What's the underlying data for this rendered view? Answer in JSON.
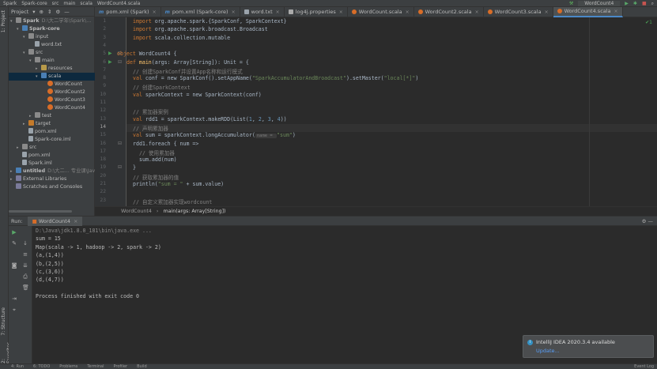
{
  "topbar": {
    "crumbs": [
      "Spark",
      "Spark-core",
      "src",
      "main",
      "scala",
      "WordCount4.scala"
    ],
    "run_config": "WordCount4"
  },
  "left_strip": {
    "project": "1: Project",
    "structure": "7: Structure",
    "favorites": "2: Favorites"
  },
  "project_panel": {
    "title": "Project",
    "tree": [
      {
        "label": "Spark",
        "extra": "D:\\大二学年\\Spark\\...",
        "icon": "folder-icon",
        "arrow": "▾"
      },
      {
        "label": "Spark-core",
        "extra": "",
        "icon": "module-icon",
        "arrow": "▾"
      },
      {
        "label": "input",
        "extra": "",
        "icon": "folder-icon",
        "arrow": "▾"
      },
      {
        "label": "word.txt",
        "extra": "",
        "icon": "text-file-icon",
        "arrow": ""
      },
      {
        "label": "src",
        "extra": "",
        "icon": "folder-icon",
        "arrow": "▾"
      },
      {
        "label": "main",
        "extra": "",
        "icon": "folder-icon",
        "arrow": "▾"
      },
      {
        "label": "resources",
        "extra": "",
        "icon": "resources-folder-icon",
        "arrow": "▸"
      },
      {
        "label": "scala",
        "extra": "",
        "icon": "source-folder-icon",
        "arrow": "▾"
      },
      {
        "label": "WordCount",
        "extra": "",
        "icon": "scala-object-icon",
        "arrow": ""
      },
      {
        "label": "WordCount2",
        "extra": "",
        "icon": "scala-object-icon",
        "arrow": ""
      },
      {
        "label": "WordCount3",
        "extra": "",
        "icon": "scala-object-icon",
        "arrow": ""
      },
      {
        "label": "WordCount4",
        "extra": "",
        "icon": "scala-object-icon",
        "arrow": ""
      },
      {
        "label": "test",
        "extra": "",
        "icon": "folder-icon",
        "arrow": "▸"
      },
      {
        "label": "target",
        "extra": "",
        "icon": "target-folder-icon",
        "arrow": "▸"
      },
      {
        "label": "pom.xml",
        "extra": "",
        "icon": "maven-file-icon",
        "arrow": ""
      },
      {
        "label": "Spark-core.iml",
        "extra": "",
        "icon": "iml-file-icon",
        "arrow": ""
      },
      {
        "label": "src",
        "extra": "",
        "icon": "folder-icon",
        "arrow": "▸"
      },
      {
        "label": "pom.xml",
        "extra": "",
        "icon": "maven-file-icon",
        "arrow": ""
      },
      {
        "label": "Spark.iml",
        "extra": "",
        "icon": "iml-file-icon",
        "arrow": ""
      },
      {
        "label": "untitled",
        "extra": "D:\\大二... 专业课\\Java课",
        "icon": "module-icon",
        "arrow": "▸"
      },
      {
        "label": "External Libraries",
        "extra": "",
        "icon": "library-icon",
        "arrow": "▸"
      },
      {
        "label": "Scratches and Consoles",
        "extra": "",
        "icon": "scratches-icon",
        "arrow": ""
      }
    ]
  },
  "tabs": [
    {
      "label": "pom.xml (Spark)",
      "icon": "m"
    },
    {
      "label": "pom.xml (Spark-core)",
      "icon": "m"
    },
    {
      "label": "word.txt",
      "icon": "txt"
    },
    {
      "label": "log4j.properties",
      "icon": "prop"
    },
    {
      "label": "WordCount.scala",
      "icon": "scala"
    },
    {
      "label": "WordCount2.scala",
      "icon": "scala"
    },
    {
      "label": "WordCount3.scala",
      "icon": "scala"
    },
    {
      "label": "WordCount4.scala",
      "icon": "scala"
    }
  ],
  "editor": {
    "line_numbers": [
      "1",
      "2",
      "3",
      "4",
      "5",
      "6",
      "7",
      "8",
      "9",
      "10",
      "11",
      "12",
      "13",
      "14",
      "15",
      "16",
      "17",
      "18",
      "19",
      "20",
      "21",
      "22",
      "23"
    ],
    "current_line": "14",
    "inspection": "✔1",
    "code": {
      "l1a": "import ",
      "l1b": "org.apache.spark.{SparkConf, SparkContext}",
      "l2a": "import ",
      "l2b": "org.apache.spark.broadcast.Broadcast",
      "l3a": "import ",
      "l3b": "scala.collection.mutable",
      "l5a": "object ",
      "l5b": "WordCount4 {",
      "l6a": "def ",
      "l6b": "main",
      "l6c": "(args: Array[String]): Unit = {",
      "l7": "// 创建SparkConf并设置App名称和运行模式",
      "l8a": "val ",
      "l8b": "conf = new SparkConf().setAppName(",
      "l8c": "\"SparkAccumulatorAndBroadcast\"",
      "l8d": ").setMaster(",
      "l8e": "\"local[*]\"",
      "l8f": ")",
      "l9": "// 创建SparkContext",
      "l10a": "val ",
      "l10b": "sparkContext = new SparkContext(conf)",
      "l12": "// 累加器案例",
      "l13a": "val ",
      "l13b": "rdd1 = sparkContext.makeRDD(List(",
      "l13c": "1",
      "l13d": ", ",
      "l13e": "2",
      "l13f": ", ",
      "l13g": "3",
      "l13h": ", ",
      "l13i": "4",
      "l13j": "))",
      "l14": "// 声明累加器",
      "l15a": "val ",
      "l15b": "sum = sparkContext.longAccumulator(",
      "l15hint": "name = ",
      "l15c": "\"sum\"",
      "l15d": ")",
      "l16": "rdd1.foreach { num =>",
      "l17": "// 使用累加器",
      "l18": "sum.add(num)",
      "l19": "}",
      "l20": "// 获取累加器的值",
      "l21a": "println(",
      "l21b": "\"sum = \"",
      "l21c": " + sum.value)",
      "l23": "// 自定义累加器实现wordcount"
    }
  },
  "breadcrumb": {
    "obj": "WordCount4",
    "method": "main(args: Array[String])"
  },
  "run": {
    "label": "Run:",
    "tab": "WordCount4",
    "output": [
      "D:\\Java\\jdk1.8.0_181\\bin\\java.exe ...",
      "sum = 15",
      "Map(scala -> 1, hadoop -> 2, spark -> 2)",
      "(a,(1,4))",
      "(b,(2,5))",
      "(c,(3,6))",
      "(d,(4,7))",
      "",
      "Process finished with exit code 0"
    ]
  },
  "notification": {
    "title": "IntelliJ IDEA 2020.3.4 available",
    "link": "Update..."
  },
  "statusbar": {
    "items": [
      "4: Run",
      "6: TODO",
      "Problems",
      "Terminal",
      "Profiler",
      "Build"
    ],
    "event_log": "Event Log"
  }
}
